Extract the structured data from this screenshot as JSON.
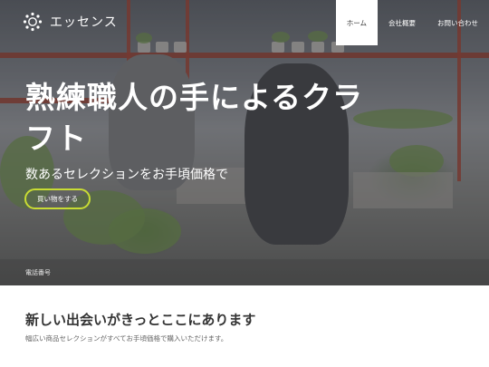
{
  "brand": {
    "name": "エッセンス",
    "logo": "sun-logo-icon"
  },
  "nav": {
    "items": [
      {
        "label": "ホーム",
        "active": true
      },
      {
        "label": "会社概要",
        "active": false
      },
      {
        "label": "お問い合わせ",
        "active": false
      }
    ]
  },
  "hero": {
    "title": "熟練職人の手によるクラフト",
    "subtitle": "数あるセレクションをお手頃価格で",
    "button_label": "買い物をする",
    "phone_label": "電話番号"
  },
  "intro": {
    "title": "新しい出会いがきっとここにあります",
    "text": "幅広い商品セレクションがすべてお手頃価格で購入いただけます。"
  },
  "colors": {
    "accent": "#c8dc33",
    "nav_active_bg": "#ffffff",
    "text_dark": "#333333",
    "text_muted": "#666666"
  }
}
